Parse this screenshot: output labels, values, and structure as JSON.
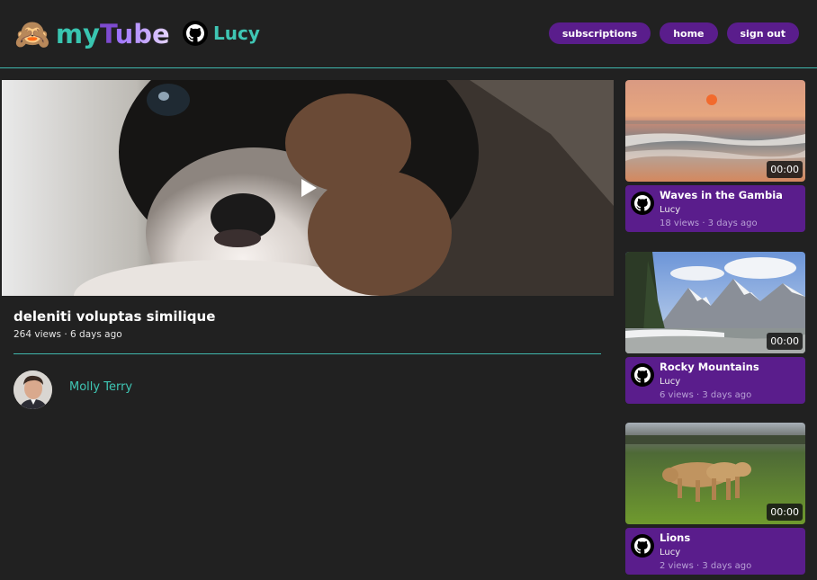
{
  "header": {
    "logo_emoji": "🙈",
    "logo_my": "my",
    "logo_t": "T",
    "logo_ube": "ube",
    "user_name": "Lucy",
    "nav": [
      "subscriptions",
      "home",
      "sign out"
    ]
  },
  "player": {
    "icon": "play-icon"
  },
  "video": {
    "title": "deleniti voluptas similique",
    "meta": "264 views · 6 days ago",
    "author": "Molly Terry"
  },
  "recommendations": [
    {
      "title": "Waves in the Gambia",
      "channel": "Lucy",
      "meta": "18 views · 3 days ago",
      "duration": "00:00"
    },
    {
      "title": "Rocky Mountains",
      "channel": "Lucy",
      "meta": "6 views · 3 days ago",
      "duration": "00:00"
    },
    {
      "title": "Lions",
      "channel": "Lucy",
      "meta": "2 views · 3 days ago",
      "duration": "00:00"
    }
  ],
  "colors": {
    "background": "#212121",
    "accent_teal": "#3fc6b4",
    "accent_purple": "#5a1d8c"
  }
}
